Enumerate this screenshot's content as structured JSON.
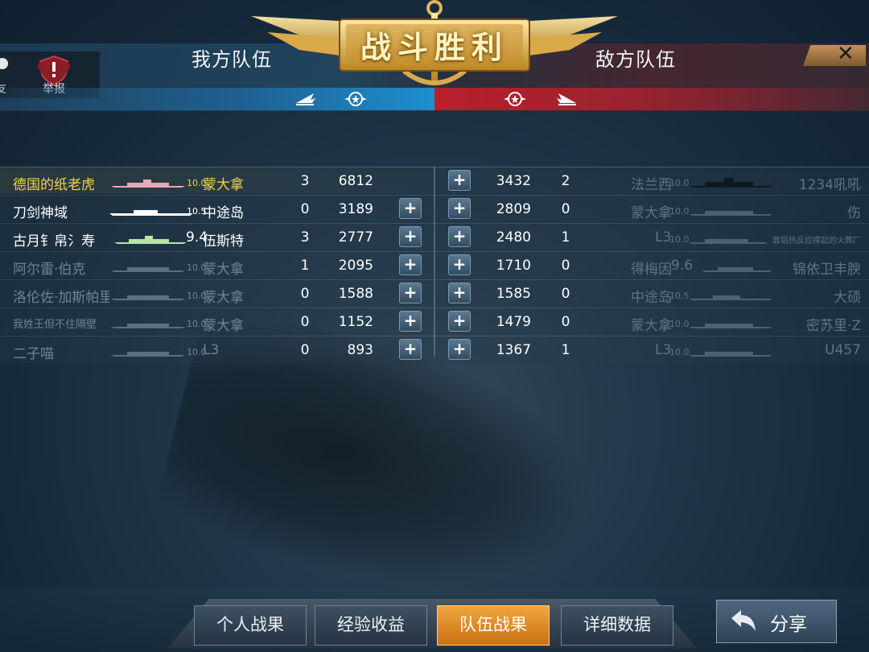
{
  "header": {
    "title": "战斗胜利",
    "our_team": "我方队伍",
    "enemy_team": "敌方队伍",
    "close": "✕"
  },
  "left_panel": {
    "friend_label": "友",
    "report_label": "举报"
  },
  "rows": [
    {
      "player": "德国的纸老虎",
      "tier": "10.0",
      "ship": "蒙大拿",
      "kills": "3",
      "score": "6812",
      "has_plus": false,
      "enemy_score": "3432",
      "enemy_kills": "2",
      "enemy_ship": "法兰西",
      "enemy_tier": "10.0",
      "enemy_player": "1234吼吼"
    },
    {
      "player": "刀剑神域",
      "tier": "10.5",
      "ship": "中途岛",
      "kills": "0",
      "score": "3189",
      "has_plus": true,
      "enemy_score": "2809",
      "enemy_kills": "0",
      "enemy_ship": "蒙大拿",
      "enemy_tier": "10.0",
      "enemy_player": "伤"
    },
    {
      "player": "古月钅帛氵寿",
      "tier": "9.4",
      "ship": "伍斯特",
      "kills": "3",
      "score": "2777",
      "has_plus": true,
      "enemy_score": "2480",
      "enemy_kills": "1",
      "enemy_ship": "L3",
      "enemy_tier": "10.0",
      "enemy_player": "靠铝热反应撑起的火葬厂"
    },
    {
      "player": "阿尔雷·伯克",
      "tier": "10.0",
      "ship": "蒙大拿",
      "kills": "1",
      "score": "2095",
      "has_plus": true,
      "enemy_score": "1710",
      "enemy_kills": "0",
      "enemy_ship": "得梅因",
      "enemy_tier": "9.6",
      "enemy_player": "锦依卫丰腴"
    },
    {
      "player": "洛伦佐·加斯帕里",
      "tier": "10.0",
      "ship": "蒙大拿",
      "kills": "0",
      "score": "1588",
      "has_plus": true,
      "enemy_score": "1585",
      "enemy_kills": "0",
      "enemy_ship": "中途岛",
      "enemy_tier": "10.5",
      "enemy_player": "大硕"
    },
    {
      "player": "我姓王但不住隔壁",
      "tier": "10.0",
      "ship": "蒙大拿",
      "kills": "0",
      "score": "1152",
      "has_plus": true,
      "enemy_score": "1479",
      "enemy_kills": "0",
      "enemy_ship": "蒙大拿",
      "enemy_tier": "10.0",
      "enemy_player": "密苏里·Z"
    },
    {
      "player": "二子喵",
      "tier": "10.0",
      "ship": "L3",
      "kills": "0",
      "score": "893",
      "has_plus": true,
      "enemy_score": "1367",
      "enemy_kills": "1",
      "enemy_ship": "L3",
      "enemy_tier": "10.0",
      "enemy_player": "U457"
    }
  ],
  "tabs": [
    "个人战果",
    "经验收益",
    "队伍战果",
    "详细数据"
  ],
  "active_tab": "队伍战果",
  "share_label": "分享",
  "colors": {
    "highlight_name": "#f0d24a",
    "active_tab": "#e89a30",
    "our_bar": "#1d8fcf",
    "enemy_bar": "#b8202a"
  }
}
